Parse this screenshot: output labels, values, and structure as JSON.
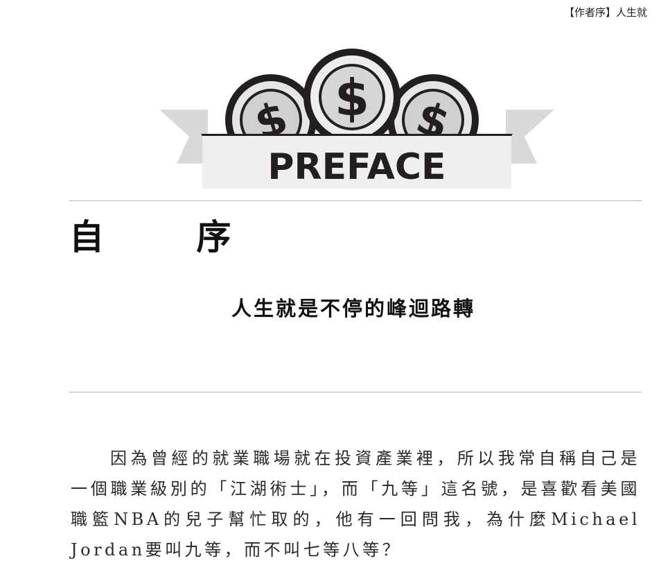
{
  "header": {
    "running_title": "【作者序】人生就"
  },
  "logo": {
    "label": "PREFACE",
    "symbol": "$"
  },
  "chapter": {
    "title": "自 序",
    "subtitle": "人生就是不停的峰迴路轉"
  },
  "body": {
    "paragraph": "因為曾經的就業職場就在投資產業裡，所以我常自稱自己是一個職業級別的「江湖術士」，而「九等」這名號，是喜歡看美國職籃NBA的兒子幫忙取的，他有一回問我，為什麼Michael Jordan要叫九等，而不叫七等八等？"
  },
  "colors": {
    "ink": "#231f20",
    "coin_fill": "#e6e6e6",
    "coin_inner": "#d0d0d0",
    "ribbon": "#d9d9d9",
    "banner": "#efefef",
    "rule": "#b5b5b5"
  }
}
